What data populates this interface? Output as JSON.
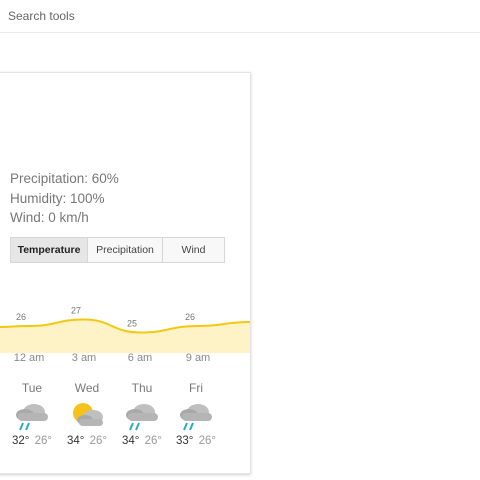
{
  "search_tools": "Search tools",
  "details": {
    "precipitation": "Precipitation: 60%",
    "humidity": "Humidity: 100%",
    "wind": "Wind: 0 km/h"
  },
  "tabs": [
    {
      "label": "Temperature",
      "active": true
    },
    {
      "label": "Precipitation",
      "active": false
    },
    {
      "label": "Wind",
      "active": false
    }
  ],
  "chart_data": {
    "type": "area",
    "labels": [
      "26",
      "27",
      "25",
      "26"
    ],
    "values": [
      26,
      27,
      25,
      26
    ],
    "x": [
      "12 am",
      "3 am",
      "6 am",
      "9 am"
    ],
    "line_color": "#f2c811",
    "fill_color": "#fdf3c6"
  },
  "forecast": [
    {
      "day": "Tue",
      "icon": "rain-cloud-icon",
      "high": "32°",
      "low": "26°"
    },
    {
      "day": "Wed",
      "icon": "sun-cloud-icon",
      "high": "34°",
      "low": "26°"
    },
    {
      "day": "Thu",
      "icon": "rain-cloud-icon",
      "high": "34°",
      "low": "26°"
    },
    {
      "day": "Fri",
      "icon": "rain-cloud-icon",
      "high": "33°",
      "low": "26°"
    }
  ]
}
